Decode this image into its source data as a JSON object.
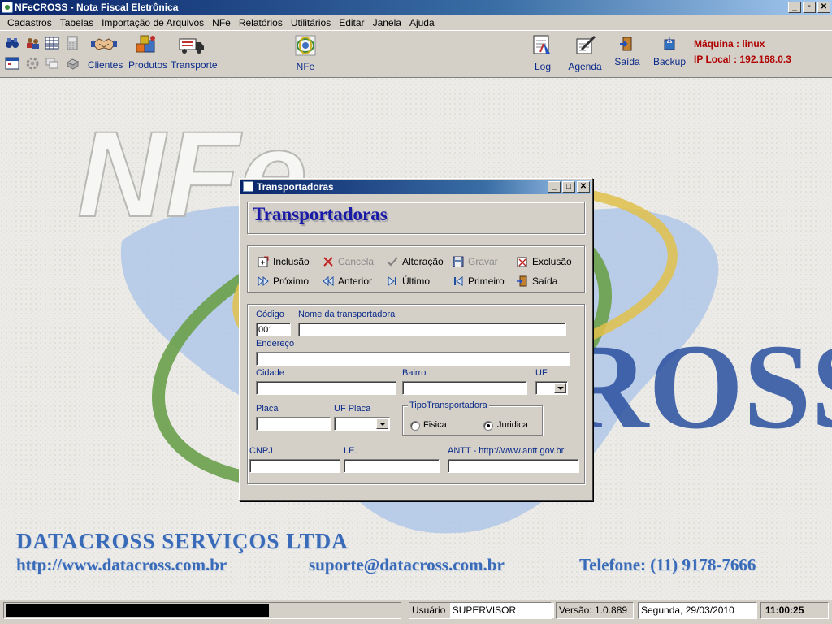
{
  "window": {
    "title": "NFeCROSS - Nota Fiscal Eletrônica"
  },
  "menu": [
    "Cadastros",
    "Tabelas",
    "Importação de Arquivos",
    "NFe",
    "Relatórios",
    "Utilitários",
    "Editar",
    "Janela",
    "Ajuda"
  ],
  "toolbar": {
    "clientes": "Clientes",
    "produtos": "Produtos",
    "transporte": "Transporte",
    "nfe": "NFe",
    "log": "Log",
    "agenda": "Agenda",
    "saida": "Saída",
    "backup": "Backup",
    "maquina_label": "Máquina :",
    "maquina_value": "linux",
    "ip_label": "IP Local :",
    "ip_value": "192.168.0.3"
  },
  "background": {
    "company": "DATACROSS SERVIÇOS LTDA",
    "site": "http://www.datacross.com.br",
    "email": "suporte@datacross.com.br",
    "phone": "Telefone: (11) 9178-7666"
  },
  "dialog": {
    "window_title": "Transportadoras",
    "heading": "Transportadoras",
    "actions": {
      "inclusao": "Inclusão",
      "cancela": "Cancela",
      "alteracao": "Alteração",
      "gravar": "Gravar",
      "exclusao": "Exclusão",
      "proximo": "Próximo",
      "anterior": "Anterior",
      "ultimo": "Último",
      "primeiro": "Primeiro",
      "saida": "Saída"
    },
    "fields": {
      "codigo_label": "Código",
      "codigo_value": "001",
      "nome_label": "Nome da transportadora",
      "endereco_label": "Endereço",
      "cidade_label": "Cidade",
      "bairro_label": "Bairro",
      "uf_label": "UF",
      "placa_label": "Placa",
      "uf_placa_label": "UF Placa",
      "tipo_label": "TipoTransportadora",
      "fisica_label": "Fisica",
      "juridica_label": "Juridica",
      "cnpj_label": "CNPJ",
      "ie_label": "I.E.",
      "antt_label": "ANTT -  http://www.antt.gov.br"
    }
  },
  "status": {
    "progress_fraction": 0.67,
    "usuario_label": "Usuário",
    "usuario_value": "SUPERVISOR",
    "versao": "Versão: 1.0.889",
    "data": "Segunda, 29/03/2010",
    "hora": "11:00:25"
  },
  "colors": {
    "titlebar": "#0a246a",
    "heading": "#1a1aa8",
    "machine_info": "#b00000",
    "footer_text": "#3a6bb8"
  }
}
